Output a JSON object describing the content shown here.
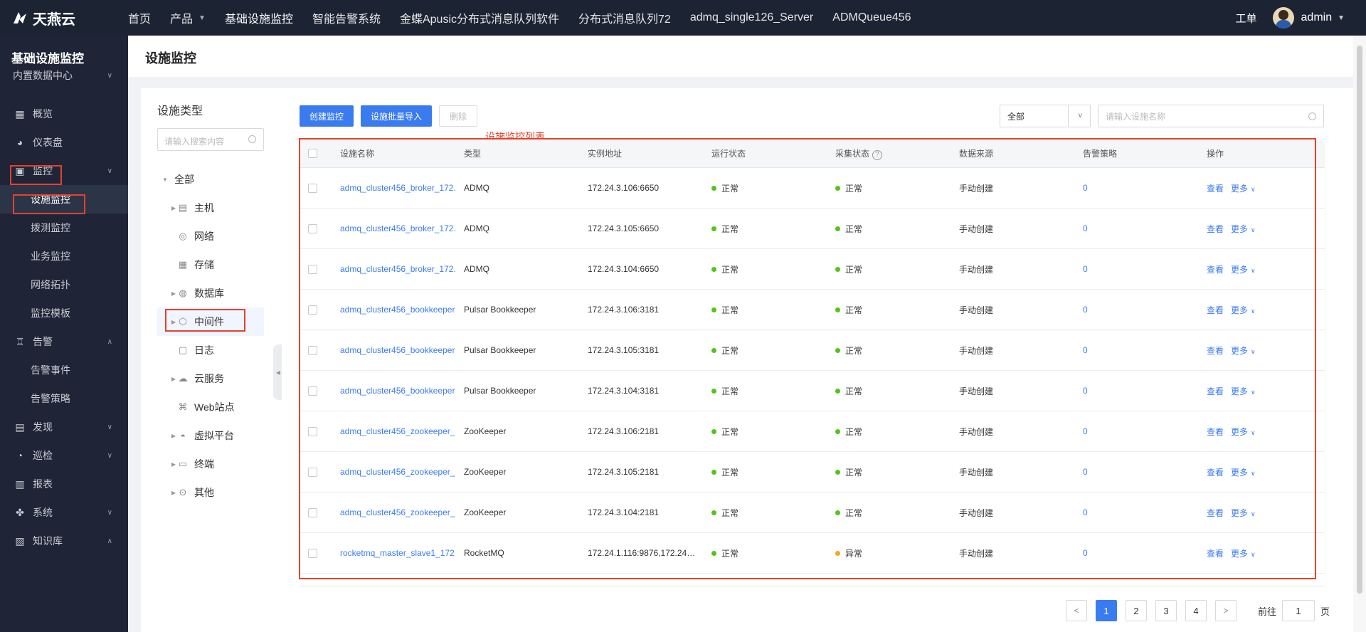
{
  "brand": {
    "name": "天燕云"
  },
  "topnav": {
    "items": [
      {
        "label": "首页",
        "active": false
      },
      {
        "label": "产品",
        "active": false,
        "dropdown": true
      },
      {
        "label": "基础设施监控",
        "active": true
      },
      {
        "label": "智能告警系统",
        "active": false
      },
      {
        "label": "金蝶Apusic分布式消息队列软件",
        "active": false
      },
      {
        "label": "分布式消息队列72",
        "active": false
      },
      {
        "label": "admq_single126_Server",
        "active": false
      },
      {
        "label": "ADMQueue456",
        "active": false
      }
    ],
    "workorder": "工单",
    "username": "admin"
  },
  "sidebar": {
    "title": "基础设施监控",
    "datacenter": "内置数据中心",
    "items": [
      {
        "label": "概览",
        "icon": "grid-icon"
      },
      {
        "label": "仪表盘",
        "icon": "dashboard-icon"
      },
      {
        "label": "监控",
        "icon": "monitor-icon",
        "expanded": true
      },
      {
        "label": "设施监控",
        "sub": true,
        "active": true
      },
      {
        "label": "拨测监控",
        "sub": true
      },
      {
        "label": "业务监控",
        "sub": true
      },
      {
        "label": "网络拓扑",
        "sub": true
      },
      {
        "label": "监控模板",
        "sub": true
      },
      {
        "label": "告警",
        "icon": "alarm-icon",
        "expanded": true
      },
      {
        "label": "告警事件",
        "sub": true
      },
      {
        "label": "告警策略",
        "sub": true
      },
      {
        "label": "发现",
        "icon": "discover-icon"
      },
      {
        "label": "巡检",
        "icon": "inspect-icon"
      },
      {
        "label": "报表",
        "icon": "report-icon"
      },
      {
        "label": "系统",
        "icon": "system-icon"
      },
      {
        "label": "知识库",
        "icon": "knowledge-icon",
        "expanded": true
      }
    ]
  },
  "page": {
    "title": "设施监控"
  },
  "tree": {
    "title": "设施类型",
    "search_placeholder": "请输入搜索内容",
    "root": "全部",
    "nodes": [
      {
        "label": "主机",
        "icon": "server-icon",
        "expandable": true
      },
      {
        "label": "网络",
        "icon": "network-icon",
        "expandable": false
      },
      {
        "label": "存储",
        "icon": "storage-icon",
        "expandable": false
      },
      {
        "label": "数据库",
        "icon": "database-icon",
        "expandable": true
      },
      {
        "label": "中间件",
        "icon": "middleware-icon",
        "expandable": true,
        "active": true
      },
      {
        "label": "日志",
        "icon": "log-icon",
        "expandable": false
      },
      {
        "label": "云服务",
        "icon": "cloud-icon",
        "expandable": true
      },
      {
        "label": "Web站点",
        "icon": "web-icon",
        "expandable": false
      },
      {
        "label": "虚拟平台",
        "icon": "virtual-icon",
        "expandable": true
      },
      {
        "label": "终端",
        "icon": "terminal-icon",
        "expandable": true
      },
      {
        "label": "其他",
        "icon": "other-icon",
        "expandable": true
      }
    ]
  },
  "toolbar": {
    "create": "创建监控",
    "import": "设施批量导入",
    "delete": "删除",
    "filter_value": "全部",
    "name_placeholder": "请输入设施名称"
  },
  "annotation": "设施监控列表",
  "table": {
    "headers": [
      "设施名称",
      "类型",
      "实例地址",
      "运行状态",
      "采集状态",
      "数据来源",
      "告警策略",
      "操作"
    ],
    "rows": [
      {
        "name": "admq_cluster456_broker_172.",
        "type": "ADMQ",
        "addr": "172.24.3.106:6650",
        "run": "正常",
        "collect": "正常",
        "collect_color": "#52c41a",
        "source": "手动创建",
        "policy": "0"
      },
      {
        "name": "admq_cluster456_broker_172.",
        "type": "ADMQ",
        "addr": "172.24.3.105:6650",
        "run": "正常",
        "collect": "正常",
        "collect_color": "#52c41a",
        "source": "手动创建",
        "policy": "0"
      },
      {
        "name": "admq_cluster456_broker_172.",
        "type": "ADMQ",
        "addr": "172.24.3.104:6650",
        "run": "正常",
        "collect": "正常",
        "collect_color": "#52c41a",
        "source": "手动创建",
        "policy": "0"
      },
      {
        "name": "admq_cluster456_bookkeeper",
        "type": "Pulsar Bookkeeper",
        "addr": "172.24.3.106:3181",
        "run": "正常",
        "collect": "正常",
        "collect_color": "#52c41a",
        "source": "手动创建",
        "policy": "0"
      },
      {
        "name": "admq_cluster456_bookkeeper",
        "type": "Pulsar Bookkeeper",
        "addr": "172.24.3.105:3181",
        "run": "正常",
        "collect": "正常",
        "collect_color": "#52c41a",
        "source": "手动创建",
        "policy": "0"
      },
      {
        "name": "admq_cluster456_bookkeeper",
        "type": "Pulsar Bookkeeper",
        "addr": "172.24.3.104:3181",
        "run": "正常",
        "collect": "正常",
        "collect_color": "#52c41a",
        "source": "手动创建",
        "policy": "0"
      },
      {
        "name": "admq_cluster456_zookeeper_",
        "type": "ZooKeeper",
        "addr": "172.24.3.106:2181",
        "run": "正常",
        "collect": "正常",
        "collect_color": "#52c41a",
        "source": "手动创建",
        "policy": "0"
      },
      {
        "name": "admq_cluster456_zookeeper_",
        "type": "ZooKeeper",
        "addr": "172.24.3.105:2181",
        "run": "正常",
        "collect": "正常",
        "collect_color": "#52c41a",
        "source": "手动创建",
        "policy": "0"
      },
      {
        "name": "admq_cluster456_zookeeper_",
        "type": "ZooKeeper",
        "addr": "172.24.3.104:2181",
        "run": "正常",
        "collect": "正常",
        "collect_color": "#52c41a",
        "source": "手动创建",
        "policy": "0"
      },
      {
        "name": "rocketmq_master_slave1_172",
        "type": "RocketMQ",
        "addr": "172.24.1.116:9876,172.24…",
        "run": "正常",
        "collect": "异常",
        "collect_color": "#f5a623",
        "source": "手动创建",
        "policy": "0"
      }
    ],
    "op_view": "查看",
    "op_more": "更多"
  },
  "pagination": {
    "pages": [
      "1",
      "2",
      "3",
      "4"
    ],
    "current": "1",
    "goto_label": "前往",
    "goto_value": "1",
    "page_suffix": "页"
  },
  "colors": {
    "primary": "#3a7bf0",
    "ok": "#52c41a",
    "warn": "#f5a623",
    "highlight": "#e4412e"
  }
}
